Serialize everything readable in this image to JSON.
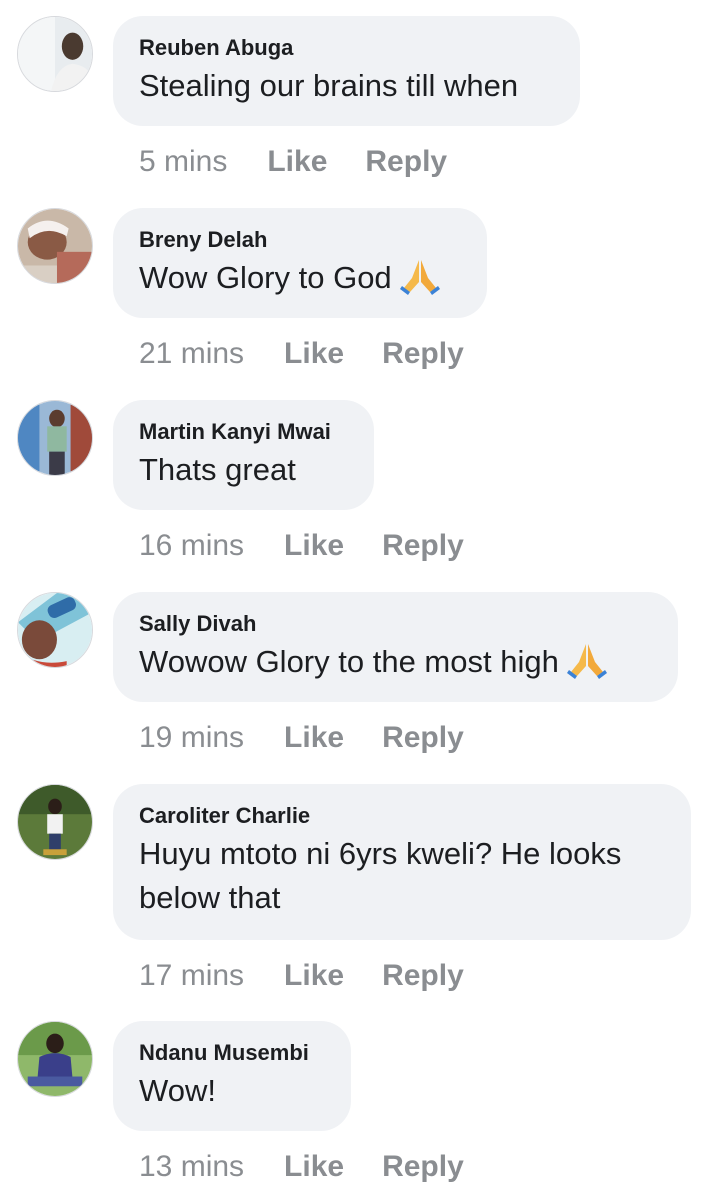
{
  "comments": [
    {
      "author": "Reuben Abuga",
      "text": "Stealing our brains till when",
      "time": "5 mins",
      "like": "Like",
      "reply": "Reply",
      "emoji": ""
    },
    {
      "author": "Breny Delah",
      "text": "Wow Glory to God",
      "time": "21 mins",
      "like": "Like",
      "reply": "Reply",
      "emoji": "folded-hands-icon"
    },
    {
      "author": "Martin Kanyi Mwai",
      "text": "Thats great",
      "time": "16 mins",
      "like": "Like",
      "reply": "Reply",
      "emoji": ""
    },
    {
      "author": "Sally Divah",
      "text": "Wowow Glory to the most high",
      "time": "19 mins",
      "like": "Like",
      "reply": "Reply",
      "emoji": "folded-hands-icon"
    },
    {
      "author": "Caroliter Charlie",
      "text": "Huyu mtoto ni 6yrs kweli? He looks below that",
      "time": "17 mins",
      "like": "Like",
      "reply": "Reply",
      "emoji": ""
    },
    {
      "author": "Ndanu Musembi",
      "text": "Wow!",
      "time": "13 mins",
      "like": "Like",
      "reply": "Reply",
      "emoji": ""
    }
  ],
  "colors": {
    "bubble": "#f0f2f5",
    "text": "#1c1e21",
    "meta": "#8a8d91"
  }
}
